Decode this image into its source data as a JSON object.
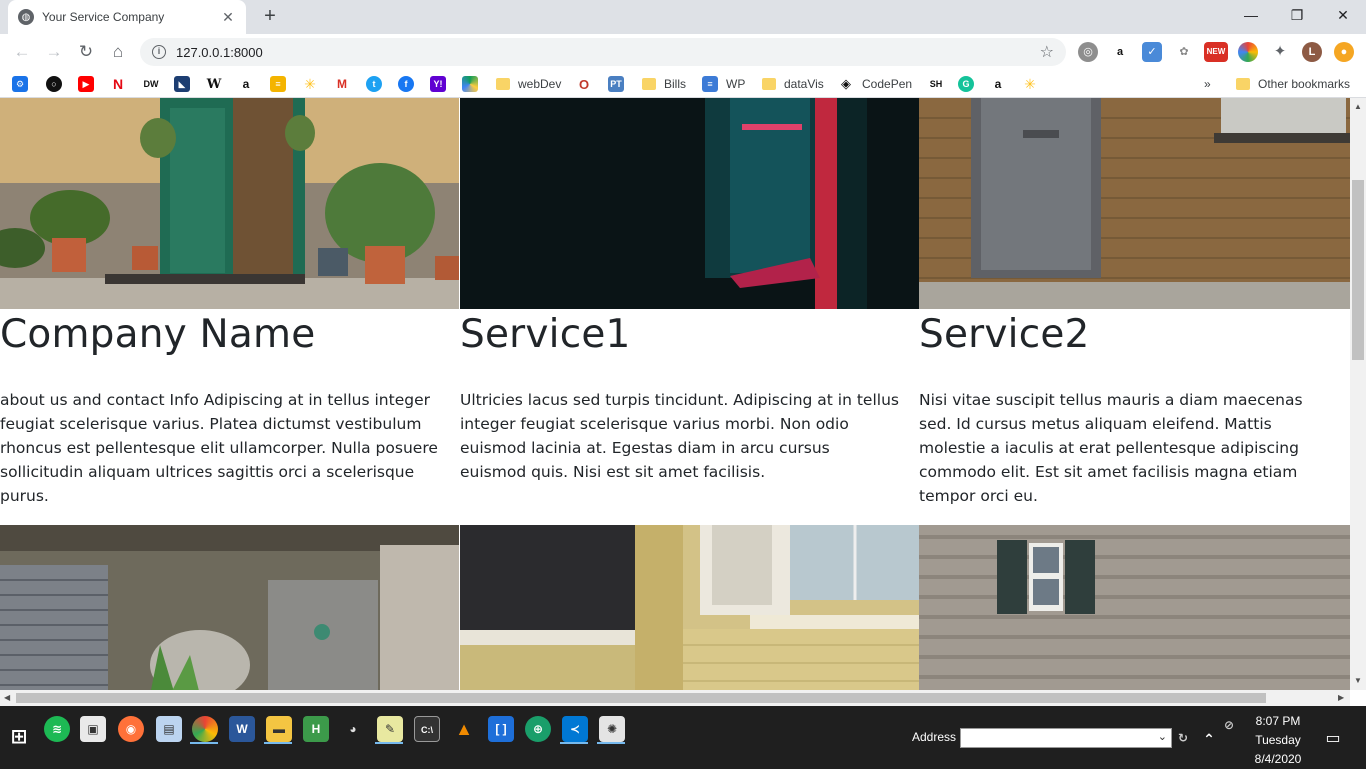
{
  "browser": {
    "tab_title": "Your Service Company",
    "url": "127.0.0.1:8000",
    "new_tab_label": "+",
    "tab_close_label": "✕"
  },
  "bookmarks": {
    "items": [
      {
        "label": "webDev",
        "type": "folder"
      },
      {
        "label": "Bills",
        "type": "folder"
      },
      {
        "label": "WP",
        "type": "link"
      },
      {
        "label": "dataVis",
        "type": "folder"
      },
      {
        "label": "CodePen",
        "type": "link"
      }
    ],
    "overflow_label": "»",
    "other_label": "Other bookmarks"
  },
  "cards": [
    {
      "title": "Company Name",
      "text": "about us and contact Info Adipiscing at in tellus integer feugiat scelerisque varius. Platea dictumst vestibulum rhoncus est pellentesque elit ullamcorper. Nulla posuere sollicitudin aliquam ultrices sagittis orci a scelerisque purus."
    },
    {
      "title": "Service1",
      "text": "Ultricies lacus sed turpis tincidunt. Adipiscing at in tellus integer feugiat scelerisque varius morbi. Non odio euismod lacinia at. Egestas diam in arcu cursus euismod quis. Nisi est sit amet facilisis."
    },
    {
      "title": "Service2",
      "text": "Nisi vitae suscipit tellus mauris a diam maecenas sed. Id cursus metus aliquam eleifend. Mattis molestie a iaculis at erat pellentesque adipiscing commodo elit. Est sit amet facilisis magna etiam tempor orci eu."
    }
  ],
  "taskbar": {
    "address_label": "Address",
    "time": "8:07 PM",
    "day": "Tuesday",
    "date": "8/4/2020"
  },
  "colors": {
    "tab_strip": "#dee1e6",
    "taskbar": "#1f1f1f",
    "text": "#212529"
  }
}
